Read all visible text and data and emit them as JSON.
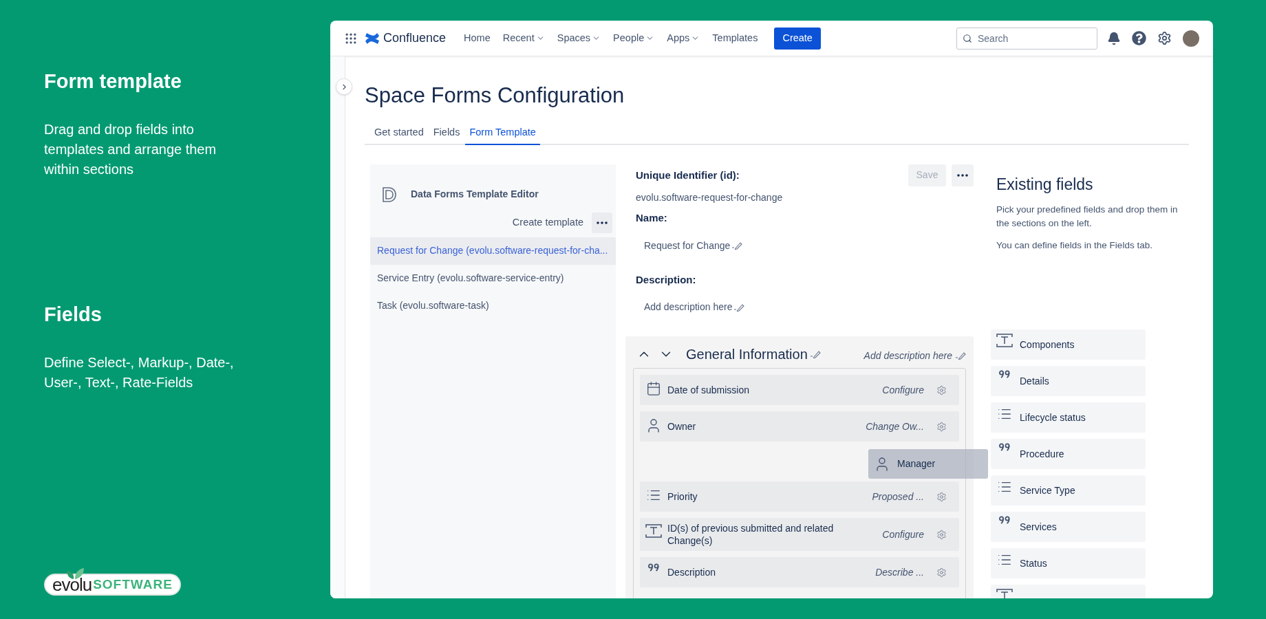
{
  "promo": {
    "sections": [
      {
        "heading": "Form template",
        "text": "Drag and drop fields into templates and arrange them within sections"
      },
      {
        "heading": "Fields",
        "text": "Define Select-, Markup-, Date-, User-, Text-, Rate-Fields"
      }
    ],
    "logo": {
      "part_1": "evolu",
      "part_2": "SOFTWARE"
    }
  },
  "nav": {
    "product": "Confluence",
    "items": [
      {
        "label": "Home",
        "dropdown": false
      },
      {
        "label": "Recent",
        "dropdown": true
      },
      {
        "label": "Spaces",
        "dropdown": true
      },
      {
        "label": "People",
        "dropdown": true
      },
      {
        "label": "Apps",
        "dropdown": true
      },
      {
        "label": "Templates",
        "dropdown": false
      }
    ],
    "create": "Create",
    "search": {
      "placeholder": "Search"
    }
  },
  "page": {
    "title": "Space Forms Configuration",
    "tabs": [
      {
        "label": "Get started",
        "selected": false
      },
      {
        "label": "Fields",
        "selected": false
      },
      {
        "label": "Form Template",
        "selected": true
      }
    ]
  },
  "template_list": {
    "title": "Data Forms Template Editor",
    "create_button": "Create template",
    "templates": [
      {
        "label": "Request for Change (evolu.software-request-for-cha...",
        "selected": true
      },
      {
        "label": "Service Entry (evolu.software-service-entry)",
        "selected": false
      },
      {
        "label": "Task (evolu.software-task)",
        "selected": false
      }
    ]
  },
  "editor": {
    "id_label": "Unique Identifier (id):",
    "id_value": "evolu.software-request-for-change",
    "name_label": "Name:",
    "name_value": "Request for Change",
    "description_label": "Description:",
    "description_placeholder": "Add description here",
    "save_button": {
      "label": "Save",
      "disabled": true
    }
  },
  "section": {
    "title": "General Information",
    "description_placeholder": "Add description here",
    "fields": [
      {
        "kind": "date",
        "label": "Date of submission",
        "action": "Configure"
      },
      {
        "kind": "user",
        "label": "Owner",
        "action": "Change Ow..."
      },
      {
        "kind": "drop_slot"
      },
      {
        "kind": "select",
        "label": "Priority",
        "action": "Proposed ..."
      },
      {
        "kind": "text",
        "label": "ID(s) of previous submitted and related Change(s)",
        "action": "Configure"
      },
      {
        "kind": "markup",
        "label": "Description",
        "action": "Describe ..."
      }
    ],
    "dragged": {
      "kind": "user",
      "label": "Manager"
    }
  },
  "existing_fields": {
    "title": "Existing fields",
    "paragraphs": [
      "Pick your predefined fields and drop them in the sections on the left.",
      "You can define fields in the Fields tab."
    ],
    "fields": [
      {
        "kind": "text",
        "label": "Components"
      },
      {
        "kind": "markup",
        "label": "Details"
      },
      {
        "kind": "select",
        "label": "Lifecycle status"
      },
      {
        "kind": "markup",
        "label": "Procedure"
      },
      {
        "kind": "select",
        "label": "Service Type"
      },
      {
        "kind": "markup",
        "label": "Services"
      },
      {
        "kind": "select",
        "label": "Status"
      },
      {
        "kind": "text"
      }
    ]
  }
}
